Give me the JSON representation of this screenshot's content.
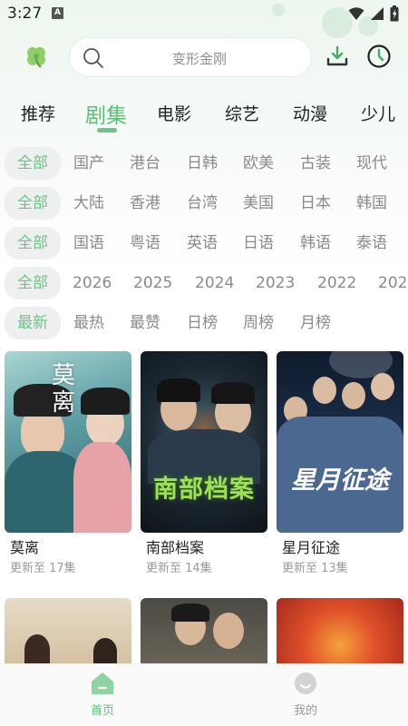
{
  "status": {
    "time": "3:27",
    "notif": "A"
  },
  "search": {
    "placeholder": "变形金刚"
  },
  "tabs": [
    "推荐",
    "剧集",
    "电影",
    "综艺",
    "动漫",
    "少儿"
  ],
  "active_tab": 1,
  "filters": {
    "type": [
      "全部",
      "国产",
      "港台",
      "日韩",
      "欧美",
      "古装",
      "现代"
    ],
    "region": [
      "全部",
      "大陆",
      "香港",
      "台湾",
      "美国",
      "日本",
      "韩国"
    ],
    "language": [
      "全部",
      "国语",
      "粤语",
      "英语",
      "日语",
      "韩语",
      "泰语"
    ],
    "year": [
      "全部",
      "2026",
      "2025",
      "2024",
      "2023",
      "2022",
      "202"
    ],
    "sort": [
      "最新",
      "最热",
      "最赞",
      "日榜",
      "周榜",
      "月榜"
    ]
  },
  "shows": [
    {
      "title": "莫离",
      "subtitle": "更新至 17集",
      "poster_text": "莫离"
    },
    {
      "title": "南部档案",
      "subtitle": "更新至 14集",
      "poster_text": "南部档案"
    },
    {
      "title": "星月征途",
      "subtitle": "更新至 13集",
      "poster_text": "星月征途"
    }
  ],
  "bottom_nav": [
    {
      "label": "首页"
    },
    {
      "label": "我的"
    }
  ],
  "colors": {
    "accent": "#5cbf7a",
    "muted": "#8a8a8a"
  }
}
